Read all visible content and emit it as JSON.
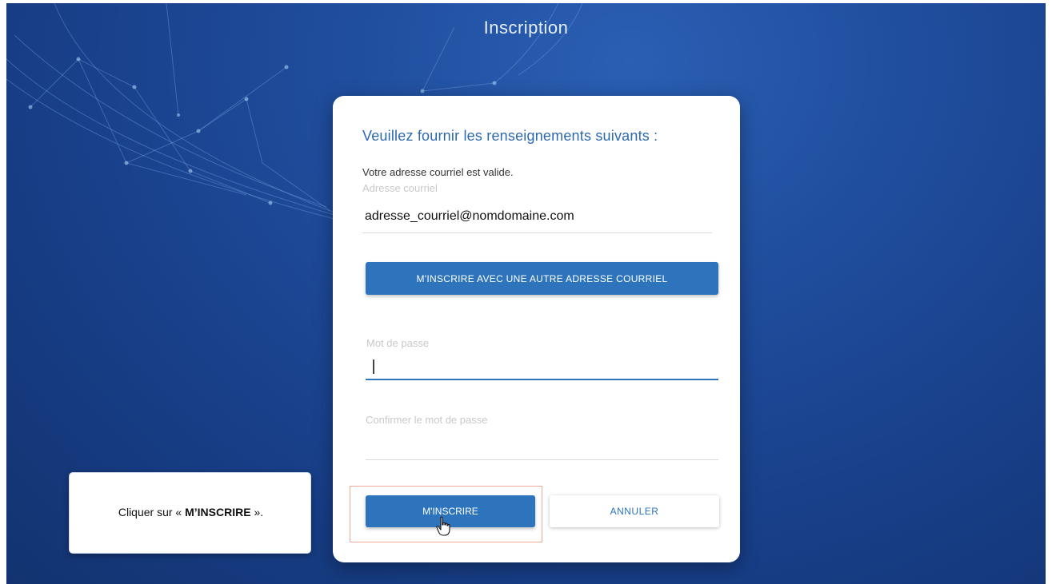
{
  "header": {
    "title": "Inscription"
  },
  "form": {
    "heading": "Veuillez fournir les renseignements suivants :",
    "valid_message": "Votre adresse courriel est valide.",
    "email_label": "Adresse courriel",
    "email_value": "adresse_courriel@nomdomaine.com",
    "other_address_button": "M'INSCRIRE AVEC UNE AUTRE ADRESSE COURRIEL",
    "password_label": "Mot de passe",
    "confirm_password_label": "Confirmer le mot de passe",
    "submit_button": "M'INSCRIRE",
    "cancel_button": "ANNULER"
  },
  "callout": {
    "prefix": "Cliquer sur « ",
    "bold": "M’INSCRIRE",
    "suffix": " »."
  },
  "colors": {
    "background": "#1f4c9c",
    "accent": "#2d74bd",
    "highlight_border": "#f0a898"
  },
  "icons": {
    "cursor": "hand-pointer-icon",
    "background": "network-mesh-decoration"
  }
}
